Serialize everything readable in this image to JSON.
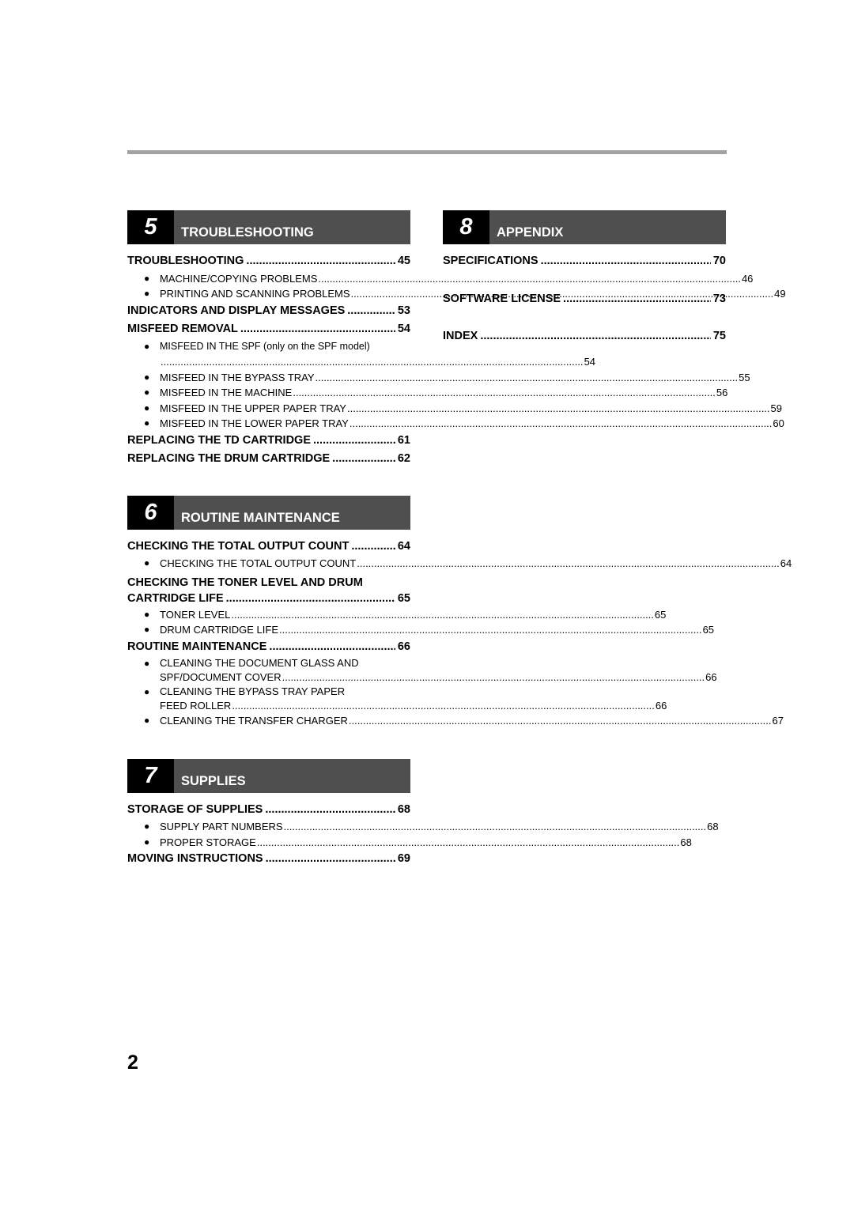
{
  "page_number": "2",
  "chapters": {
    "ch5": {
      "number": "5",
      "title": "TROUBLESHOOTING",
      "entries": {
        "e1": {
          "label": "TROUBLESHOOTING",
          "page": "45",
          "subs": [
            {
              "label": "MACHINE/COPYING PROBLEMS",
              "page": "46"
            },
            {
              "label": "PRINTING AND SCANNING PROBLEMS",
              "page": "49"
            }
          ]
        },
        "e2": {
          "label": "INDICATORS AND DISPLAY MESSAGES",
          "page": "53"
        },
        "e3": {
          "label": "MISFEED REMOVAL",
          "page": "54",
          "sub_spf_label": "MISFEED IN THE SPF (only on the SPF model)",
          "sub_spf_page": "54",
          "subs": [
            {
              "label": "MISFEED IN THE BYPASS TRAY",
              "page": "55"
            },
            {
              "label": "MISFEED IN THE MACHINE",
              "page": "56"
            },
            {
              "label": "MISFEED IN THE UPPER PAPER TRAY",
              "page": "59"
            },
            {
              "label": "MISFEED IN THE LOWER PAPER TRAY",
              "page": "60"
            }
          ]
        },
        "e4": {
          "label": "REPLACING THE TD CARTRIDGE",
          "page": "61"
        },
        "e5": {
          "label": "REPLACING THE DRUM CARTRIDGE",
          "page": "62"
        }
      }
    },
    "ch6": {
      "number": "6",
      "title": "ROUTINE MAINTENANCE",
      "entries": {
        "e1": {
          "label": "CHECKING THE TOTAL OUTPUT COUNT",
          "page": "64",
          "subs": [
            {
              "label": "CHECKING THE TOTAL OUTPUT COUNT",
              "page": "64"
            }
          ]
        },
        "e2": {
          "label_line1": "CHECKING THE TONER LEVEL AND DRUM",
          "label_line2": "CARTRIDGE LIFE",
          "page": "65",
          "subs": [
            {
              "label": "TONER LEVEL",
              "page": "65"
            },
            {
              "label": "DRUM CARTRIDGE LIFE",
              "page": "65"
            }
          ]
        },
        "e3": {
          "label": "ROUTINE MAINTENANCE",
          "page": "66",
          "subs": [
            {
              "line1": "CLEANING THE DOCUMENT GLASS AND",
              "label": "SPF/DOCUMENT COVER",
              "page": "66"
            },
            {
              "line1": "CLEANING THE BYPASS TRAY PAPER",
              "label": "FEED ROLLER",
              "page": "66"
            },
            {
              "label": "CLEANING THE TRANSFER CHARGER",
              "page": "67"
            }
          ]
        }
      }
    },
    "ch7": {
      "number": "7",
      "title": "SUPPLIES",
      "entries": {
        "e1": {
          "label": "STORAGE OF SUPPLIES",
          "page": "68",
          "subs": [
            {
              "label": "SUPPLY PART NUMBERS",
              "page": "68"
            },
            {
              "label": "PROPER STORAGE",
              "page": "68"
            }
          ]
        },
        "e2": {
          "label": "MOVING INSTRUCTIONS",
          "page": "69"
        }
      }
    },
    "ch8": {
      "number": "8",
      "title": "APPENDIX",
      "entries": {
        "e1": {
          "label": "SPECIFICATIONS",
          "page": "70"
        },
        "e2": {
          "label": "SOFTWARE LICENSE",
          "page": "73"
        },
        "e3": {
          "label": "INDEX",
          "page": "75"
        }
      }
    }
  },
  "bullet_icon": "●"
}
